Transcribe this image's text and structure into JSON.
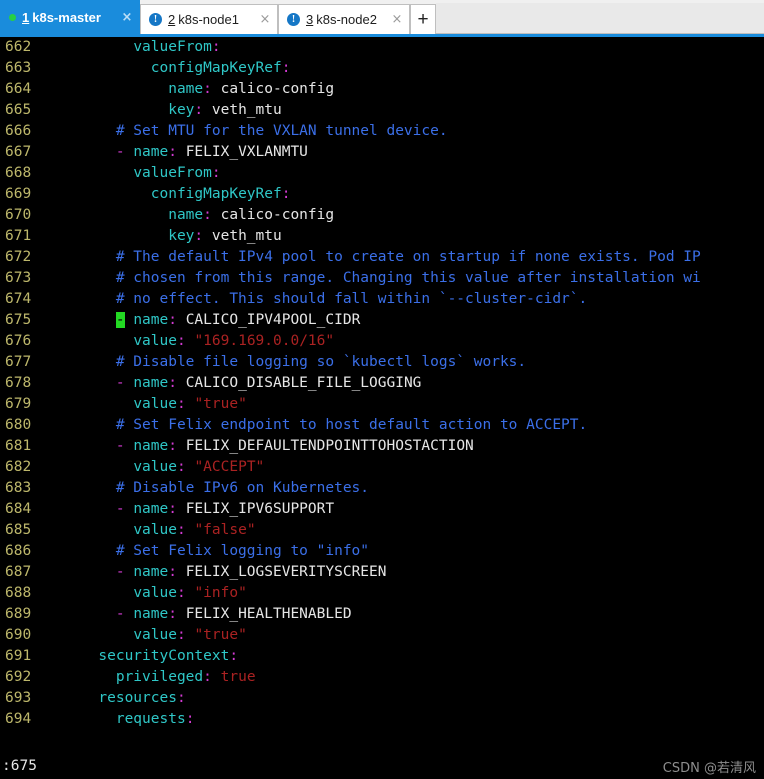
{
  "tabbar": {
    "tabs": [
      {
        "index": "1",
        "label": "k8s-master",
        "active": true,
        "icon": "green-status-dot",
        "close_glyph": "×"
      },
      {
        "index": "2",
        "label": "k8s-node1",
        "active": false,
        "icon": "blue-info-icon",
        "icon_glyph": "!",
        "close_glyph": "×"
      },
      {
        "index": "3",
        "label": "k8s-node2",
        "active": false,
        "icon": "blue-info-icon",
        "icon_glyph": "!",
        "close_glyph": "×"
      }
    ],
    "new_tab_label": "+",
    "accent_color": "#1a8cdc"
  },
  "editor": {
    "first_line": 662,
    "cursor_line": 675,
    "status_line": ":675",
    "colors": {
      "background": "#000000",
      "line_number": "#bdb76b",
      "key": "#2fc7c7",
      "punctuation": "#d33bd3",
      "plain": "#e6e6e6",
      "comment": "#3b6fe8",
      "string": "#aa2222",
      "cursor": "#23d923"
    },
    "lines": [
      {
        "n": "662",
        "indent": 10,
        "tokens": [
          {
            "t": "valueFrom",
            "c": "key"
          },
          {
            "t": ":",
            "c": "punct"
          }
        ]
      },
      {
        "n": "663",
        "indent": 12,
        "tokens": [
          {
            "t": "configMapKeyRef",
            "c": "key"
          },
          {
            "t": ":",
            "c": "punct"
          }
        ]
      },
      {
        "n": "664",
        "indent": 14,
        "tokens": [
          {
            "t": "name",
            "c": "key"
          },
          {
            "t": ":",
            "c": "punct"
          },
          {
            "t": " calico-config",
            "c": "plain"
          }
        ]
      },
      {
        "n": "665",
        "indent": 14,
        "tokens": [
          {
            "t": "key",
            "c": "key"
          },
          {
            "t": ":",
            "c": "punct"
          },
          {
            "t": " veth_mtu",
            "c": "plain"
          }
        ]
      },
      {
        "n": "666",
        "indent": 8,
        "tokens": [
          {
            "t": "# Set MTU for the VXLAN tunnel device.",
            "c": "comment"
          }
        ]
      },
      {
        "n": "667",
        "indent": 8,
        "tokens": [
          {
            "t": "-",
            "c": "punct"
          },
          {
            "t": " ",
            "c": "plain"
          },
          {
            "t": "name",
            "c": "key"
          },
          {
            "t": ":",
            "c": "punct"
          },
          {
            "t": " FELIX_VXLANMTU",
            "c": "plain"
          }
        ]
      },
      {
        "n": "668",
        "indent": 10,
        "tokens": [
          {
            "t": "valueFrom",
            "c": "key"
          },
          {
            "t": ":",
            "c": "punct"
          }
        ]
      },
      {
        "n": "669",
        "indent": 12,
        "tokens": [
          {
            "t": "configMapKeyRef",
            "c": "key"
          },
          {
            "t": ":",
            "c": "punct"
          }
        ]
      },
      {
        "n": "670",
        "indent": 14,
        "tokens": [
          {
            "t": "name",
            "c": "key"
          },
          {
            "t": ":",
            "c": "punct"
          },
          {
            "t": " calico-config",
            "c": "plain"
          }
        ]
      },
      {
        "n": "671",
        "indent": 14,
        "tokens": [
          {
            "t": "key",
            "c": "key"
          },
          {
            "t": ":",
            "c": "punct"
          },
          {
            "t": " veth_mtu",
            "c": "plain"
          }
        ]
      },
      {
        "n": "672",
        "indent": 8,
        "tokens": [
          {
            "t": "# The default IPv4 pool to create on startup if none exists. Pod IP",
            "c": "comment"
          }
        ]
      },
      {
        "n": "673",
        "indent": 8,
        "tokens": [
          {
            "t": "# chosen from this range. Changing this value after installation wi",
            "c": "comment"
          }
        ]
      },
      {
        "n": "674",
        "indent": 8,
        "tokens": [
          {
            "t": "# no effect. This should fall within `--cluster-cidr`.",
            "c": "comment"
          }
        ]
      },
      {
        "n": "675",
        "indent": 8,
        "tokens": [
          {
            "t": "-",
            "c": "cursor"
          },
          {
            "t": " ",
            "c": "plain"
          },
          {
            "t": "name",
            "c": "key"
          },
          {
            "t": ":",
            "c": "punct"
          },
          {
            "t": " CALICO_IPV4POOL_CIDR",
            "c": "plain"
          }
        ]
      },
      {
        "n": "676",
        "indent": 10,
        "tokens": [
          {
            "t": "value",
            "c": "key"
          },
          {
            "t": ":",
            "c": "punct"
          },
          {
            "t": " ",
            "c": "plain"
          },
          {
            "t": "\"169.169.0.0/16\"",
            "c": "string"
          }
        ]
      },
      {
        "n": "677",
        "indent": 8,
        "tokens": [
          {
            "t": "# Disable file logging so `kubectl logs` works.",
            "c": "comment"
          }
        ]
      },
      {
        "n": "678",
        "indent": 8,
        "tokens": [
          {
            "t": "-",
            "c": "punct"
          },
          {
            "t": " ",
            "c": "plain"
          },
          {
            "t": "name",
            "c": "key"
          },
          {
            "t": ":",
            "c": "punct"
          },
          {
            "t": " CALICO_DISABLE_FILE_LOGGING",
            "c": "plain"
          }
        ]
      },
      {
        "n": "679",
        "indent": 10,
        "tokens": [
          {
            "t": "value",
            "c": "key"
          },
          {
            "t": ":",
            "c": "punct"
          },
          {
            "t": " ",
            "c": "plain"
          },
          {
            "t": "\"true\"",
            "c": "string"
          }
        ]
      },
      {
        "n": "680",
        "indent": 8,
        "tokens": [
          {
            "t": "# Set Felix endpoint to host default action to ACCEPT.",
            "c": "comment"
          }
        ]
      },
      {
        "n": "681",
        "indent": 8,
        "tokens": [
          {
            "t": "-",
            "c": "punct"
          },
          {
            "t": " ",
            "c": "plain"
          },
          {
            "t": "name",
            "c": "key"
          },
          {
            "t": ":",
            "c": "punct"
          },
          {
            "t": " FELIX_DEFAULTENDPOINTTOHOSTACTION",
            "c": "plain"
          }
        ]
      },
      {
        "n": "682",
        "indent": 10,
        "tokens": [
          {
            "t": "value",
            "c": "key"
          },
          {
            "t": ":",
            "c": "punct"
          },
          {
            "t": " ",
            "c": "plain"
          },
          {
            "t": "\"ACCEPT\"",
            "c": "string"
          }
        ]
      },
      {
        "n": "683",
        "indent": 8,
        "tokens": [
          {
            "t": "# Disable IPv6 on Kubernetes.",
            "c": "comment"
          }
        ]
      },
      {
        "n": "684",
        "indent": 8,
        "tokens": [
          {
            "t": "-",
            "c": "punct"
          },
          {
            "t": " ",
            "c": "plain"
          },
          {
            "t": "name",
            "c": "key"
          },
          {
            "t": ":",
            "c": "punct"
          },
          {
            "t": " FELIX_IPV6SUPPORT",
            "c": "plain"
          }
        ]
      },
      {
        "n": "685",
        "indent": 10,
        "tokens": [
          {
            "t": "value",
            "c": "key"
          },
          {
            "t": ":",
            "c": "punct"
          },
          {
            "t": " ",
            "c": "plain"
          },
          {
            "t": "\"false\"",
            "c": "string"
          }
        ]
      },
      {
        "n": "686",
        "indent": 8,
        "tokens": [
          {
            "t": "# Set Felix logging to \"info\"",
            "c": "comment"
          }
        ]
      },
      {
        "n": "687",
        "indent": 8,
        "tokens": [
          {
            "t": "-",
            "c": "punct"
          },
          {
            "t": " ",
            "c": "plain"
          },
          {
            "t": "name",
            "c": "key"
          },
          {
            "t": ":",
            "c": "punct"
          },
          {
            "t": " FELIX_LOGSEVERITYSCREEN",
            "c": "plain"
          }
        ]
      },
      {
        "n": "688",
        "indent": 10,
        "tokens": [
          {
            "t": "value",
            "c": "key"
          },
          {
            "t": ":",
            "c": "punct"
          },
          {
            "t": " ",
            "c": "plain"
          },
          {
            "t": "\"info\"",
            "c": "string"
          }
        ]
      },
      {
        "n": "689",
        "indent": 8,
        "tokens": [
          {
            "t": "-",
            "c": "punct"
          },
          {
            "t": " ",
            "c": "plain"
          },
          {
            "t": "name",
            "c": "key"
          },
          {
            "t": ":",
            "c": "punct"
          },
          {
            "t": " FELIX_HEALTHENABLED",
            "c": "plain"
          }
        ]
      },
      {
        "n": "690",
        "indent": 10,
        "tokens": [
          {
            "t": "value",
            "c": "key"
          },
          {
            "t": ":",
            "c": "punct"
          },
          {
            "t": " ",
            "c": "plain"
          },
          {
            "t": "\"true\"",
            "c": "string"
          }
        ]
      },
      {
        "n": "691",
        "indent": 6,
        "tokens": [
          {
            "t": "securityContext",
            "c": "key"
          },
          {
            "t": ":",
            "c": "punct"
          }
        ]
      },
      {
        "n": "692",
        "indent": 8,
        "tokens": [
          {
            "t": "privileged",
            "c": "key"
          },
          {
            "t": ":",
            "c": "punct"
          },
          {
            "t": " ",
            "c": "plain"
          },
          {
            "t": "true",
            "c": "bool"
          }
        ]
      },
      {
        "n": "693",
        "indent": 6,
        "tokens": [
          {
            "t": "resources",
            "c": "key"
          },
          {
            "t": ":",
            "c": "punct"
          }
        ]
      },
      {
        "n": "694",
        "indent": 8,
        "tokens": [
          {
            "t": "requests",
            "c": "key"
          },
          {
            "t": ":",
            "c": "punct"
          }
        ]
      }
    ]
  },
  "watermark": "CSDN @若清风"
}
